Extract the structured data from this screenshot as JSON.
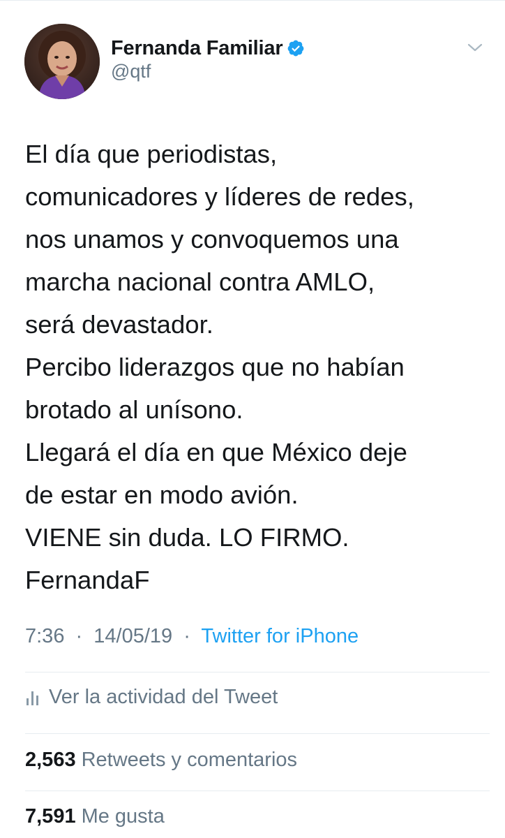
{
  "user": {
    "display_name": "Fernanda Familiar",
    "handle": "@qtf",
    "verified": true
  },
  "tweet": {
    "lines": [
      "El día que periodistas,",
      "comunicadores y líderes de redes,",
      "nos unamos y convoquemos una",
      "marcha nacional contra AMLO,",
      "será devastador.",
      "Percibo liderazgos que no habían",
      "brotado al unísono.",
      "Llegará el día en que México deje",
      "de estar en modo avión.",
      "VIENE sin duda. LO FIRMO.",
      "FernandaF"
    ]
  },
  "meta": {
    "time": "7:36",
    "separator1": "·",
    "date": "14/05/19",
    "separator2": "·",
    "source": "Twitter for iPhone"
  },
  "activity": {
    "label": "Ver la actividad del Tweet"
  },
  "stats": {
    "retweets_count": "2,563",
    "retweets_label": "Retweets y comentarios",
    "likes_count": "7,591",
    "likes_label": "Me gusta"
  },
  "colors": {
    "text_primary": "#14171a",
    "text_secondary": "#657786",
    "link": "#1da1f2",
    "divider": "#e6ecf0",
    "verified_badge": "#1da1f2"
  },
  "icons": {
    "verified": "verified-badge-icon",
    "caret": "chevron-down-icon",
    "activity": "bar-chart-icon"
  }
}
